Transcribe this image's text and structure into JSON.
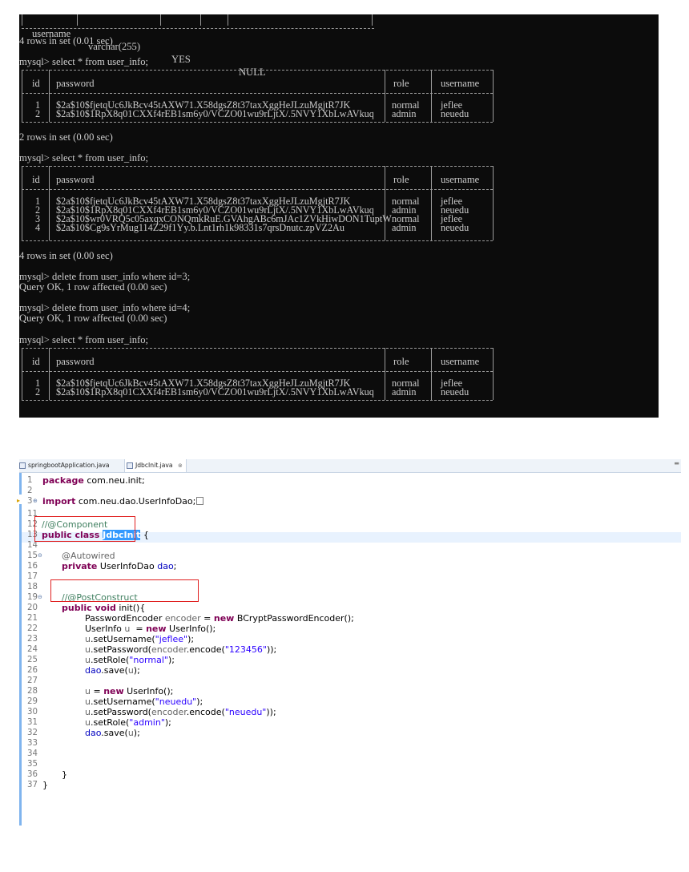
{
  "terminal": {
    "top_row": [
      "username",
      "varchar(255)",
      "YES",
      "",
      "NULL"
    ],
    "lines": [
      {
        "text": "4 rows in set (0.01 sec)"
      },
      {
        "text": "mysql> select * from user_info;"
      },
      {
        "text": "2 rows in set (0.00 sec)"
      },
      {
        "text": "mysql> select * from user_info;"
      },
      {
        "text": "4 rows in set (0.00 sec)"
      },
      {
        "text": "mysql> delete from user_info where id=3;"
      },
      {
        "text": "Query OK, 1 row affected (0.00 sec)"
      },
      {
        "text": "mysql> delete from user_info where id=4;"
      },
      {
        "text": "Query OK, 1 row affected (0.00 sec)"
      },
      {
        "text": "mysql> select * from user_info;"
      }
    ],
    "headers": [
      "id",
      "password",
      "role",
      "username"
    ],
    "tables": [
      {
        "rows": [
          [
            "1",
            "$2a$10$fjetqUc6JkBcv45tAXW71.X58dgsZ8t37taxXggHeJLzuMgjtR7JK",
            "normal",
            "jeflee"
          ],
          [
            "2",
            "$2a$10$1RpX8q01CXXf4rEB1sm6y0/VCZO01wu9rLjtX/.5NVY1XbLwAVkuq",
            "admin",
            "neuedu"
          ]
        ]
      },
      {
        "rows": [
          [
            "1",
            "$2a$10$fjetqUc6JkBcv45tAXW71.X58dgsZ8t37taxXggHeJLzuMgjtR7JK",
            "normal",
            "jeflee"
          ],
          [
            "2",
            "$2a$10$1RpX8q01CXXf4rEB1sm6y0/VCZO01wu9rLjtX/.5NVY1XbLwAVkuq",
            "admin",
            "neuedu"
          ],
          [
            "3",
            "$2a$10$wr0VRQ5c05axqxCONQmkRuE.GVAhgABc6mJAc1ZVkHiwDON1TuptW",
            "normal",
            "jeflee"
          ],
          [
            "4",
            "$2a$10$Cg9sYrMug114Z29f1Yy.b.Lnt1rh1k98331s7qrsDnutc.zpVZ2Au",
            "admin",
            "neuedu"
          ]
        ]
      },
      {
        "rows": [
          [
            "1",
            "$2a$10$fjetqUc6JkBcv45tAXW71.X58dgsZ8t37taxXggHeJLzuMgjtR7JK",
            "normal",
            "jeflee"
          ],
          [
            "2",
            "$2a$10$1RpX8q01CXXf4rEB1sm6y0/VCZO01wu9rLjtX/.5NVY1XbLwAVkuq",
            "admin",
            "neuedu"
          ]
        ]
      }
    ]
  },
  "editor": {
    "tabs": [
      {
        "label": "springbootApplication.java",
        "icon": "java-file-icon",
        "active": false
      },
      {
        "label": "JdbcInit.java",
        "icon": "java-file-icon",
        "active": true,
        "close": "⊗"
      }
    ],
    "line_numbers": [
      "1",
      "2",
      "3",
      "11",
      "12",
      "13",
      "14",
      "15",
      "16",
      "17",
      "18",
      "19",
      "20",
      "21",
      "22",
      "23",
      "24",
      "25",
      "26",
      "27",
      "28",
      "29",
      "30",
      "31",
      "32",
      "33",
      "34",
      "35",
      "36",
      "37"
    ],
    "code": {
      "l1_kw": "package",
      "l1_rest": " com.neu.init;",
      "l3_kw": "import",
      "l3_rest": " com.neu.dao.UserInfoDao;",
      "l12": "//@Component",
      "l13_kw": "public class ",
      "l13_sel": "JdbcInit",
      "l13_rest": " {",
      "l15": "@Autowired",
      "l16_kw": "private",
      "l16_type": " UserInfoDao ",
      "l16_fld": "dao",
      "l16_end": ";",
      "l18": "//@PostConstruct",
      "l19_kw": "public void",
      "l19_rest": " init(){",
      "l20_a": "PasswordEncoder ",
      "l20_var": "encoder",
      "l20_b": " = ",
      "l20_kw": "new",
      "l20_c": " BCryptPasswordEncoder();",
      "l21_a": "UserInfo ",
      "l21_var": "u",
      "l21_b": "  = ",
      "l21_kw": "new",
      "l21_c": " UserInfo();",
      "l22_a": "u",
      "l22_b": ".setUsername(",
      "l22_s": "\"jeflee\"",
      "l22_c": ");",
      "l23_a": "u",
      "l23_b": ".setPassword(",
      "l23_e": "encoder",
      "l23_c": ".encode(",
      "l23_s": "\"123456\"",
      "l23_d": "));",
      "l24_a": "u",
      "l24_b": ".setRole(",
      "l24_s": "\"normal\"",
      "l24_c": ");",
      "l25_a": "dao",
      "l25_b": ".save(",
      "l25_u": "u",
      "l25_c": ");",
      "l27_a": "u",
      "l27_b": " = ",
      "l27_kw": "new",
      "l27_c": " UserInfo();",
      "l28_a": "u",
      "l28_b": ".setUsername(",
      "l28_s": "\"neuedu\"",
      "l28_c": ");",
      "l29_a": "u",
      "l29_b": ".setPassword(",
      "l29_e": "encoder",
      "l29_c": ".encode(",
      "l29_s": "\"neuedu\"",
      "l29_d": "));",
      "l30_a": "u",
      "l30_b": ".setRole(",
      "l30_s": "\"admin\"",
      "l30_c": ");",
      "l31_a": "dao",
      "l31_b": ".save(",
      "l31_u": "u",
      "l31_c": ");",
      "l35": "}",
      "l36": "}"
    },
    "colors": {
      "keyword": "#7f0055",
      "comment": "#3f7f5f",
      "string": "#2a00ff",
      "field": "#0000c0",
      "highlight_box": "#e02020",
      "selection": "#3399ff"
    }
  }
}
